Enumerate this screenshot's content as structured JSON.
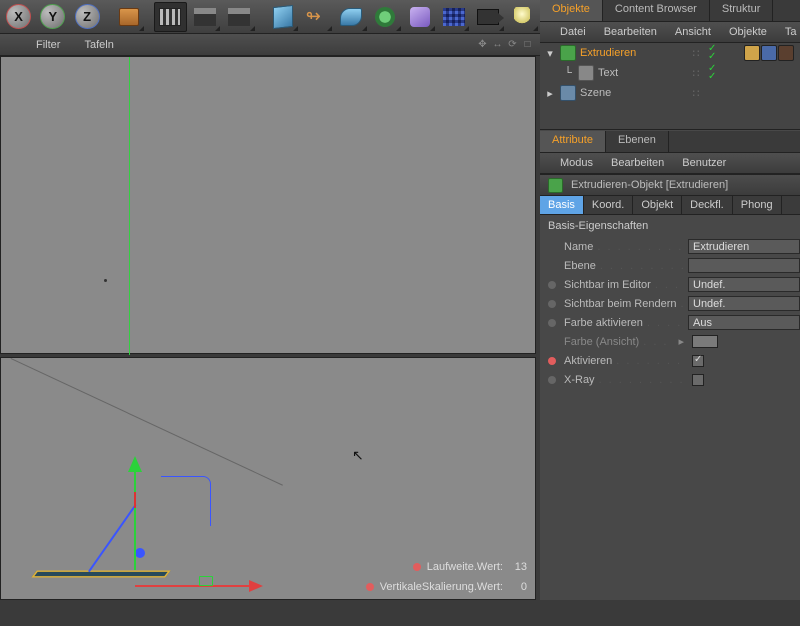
{
  "toolbar": {
    "axis": {
      "x": "X",
      "y": "Y",
      "z": "Z"
    }
  },
  "ribbon": {
    "filter": "Filter",
    "tafeln": "Tafeln"
  },
  "viewport_icons": [
    "✥",
    "↔",
    "⟳",
    "□"
  ],
  "hud": {
    "row1_label": "Laufweite.Wert:",
    "row1_value": "13",
    "row2_label": "VertikaleSkalierung.Wert:",
    "row2_value": "0"
  },
  "panels": {
    "tabs1": {
      "objekte": "Objekte",
      "content_browser": "Content Browser",
      "struktur": "Struktur"
    },
    "menu1": {
      "datei": "Datei",
      "bearbeiten": "Bearbeiten",
      "ansicht": "Ansicht",
      "objekte": "Objekte",
      "ta": "Ta"
    },
    "tree": {
      "row0": "Extrudieren",
      "row1": "Text",
      "row2": "Szene"
    },
    "tabs2": {
      "attribute": "Attribute",
      "ebenen": "Ebenen"
    },
    "menu2": {
      "modus": "Modus",
      "bearbeiten": "Bearbeiten",
      "benutzer": "Benutzer"
    },
    "obj_header": "Extrudieren-Objekt [Extrudieren]",
    "subtabs": {
      "basis": "Basis",
      "koord": "Koord.",
      "objekt": "Objekt",
      "deckfl": "Deckfl.",
      "phong": "Phong"
    },
    "section": "Basis-Eigenschaften",
    "props": {
      "name_lbl": "Name",
      "name_val": "Extrudieren",
      "ebene_lbl": "Ebene",
      "ebene_val": "",
      "vis_ed_lbl": "Sichtbar im Editor",
      "vis_ed_val": "Undef.",
      "vis_rn_lbl": "Sichtbar beim Rendern",
      "vis_rn_val": "Undef.",
      "farbe_akt_lbl": "Farbe aktivieren",
      "farbe_akt_val": "Aus",
      "farbe_ans_lbl": "Farbe (Ansicht)",
      "aktiv_lbl": "Aktivieren",
      "xray_lbl": "X-Ray"
    }
  }
}
